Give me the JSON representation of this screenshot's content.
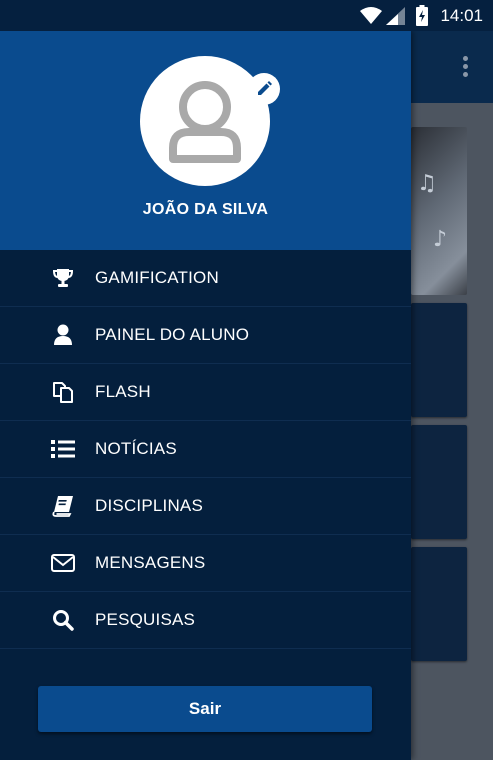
{
  "status_bar": {
    "time": "14:01"
  },
  "profile": {
    "name": "JOÃO DA SILVA"
  },
  "menu": {
    "items": [
      {
        "label": "GAMIFICATION",
        "icon": "trophy-icon"
      },
      {
        "label": "PAINEL DO ALUNO",
        "icon": "user-icon"
      },
      {
        "label": "FLASH",
        "icon": "copy-icon"
      },
      {
        "label": "NOTÍCIAS",
        "icon": "list-icon"
      },
      {
        "label": "DISCIPLINAS",
        "icon": "book-icon"
      },
      {
        "label": "MENSAGENS",
        "icon": "envelope-icon"
      },
      {
        "label": "PESQUISAS",
        "icon": "search-icon"
      }
    ]
  },
  "logout": {
    "label": "Sair"
  },
  "colors": {
    "header": "#0a4b8e",
    "drawer": "#041f3d",
    "status_bar": "#05203f",
    "button": "#0a4b8e"
  }
}
